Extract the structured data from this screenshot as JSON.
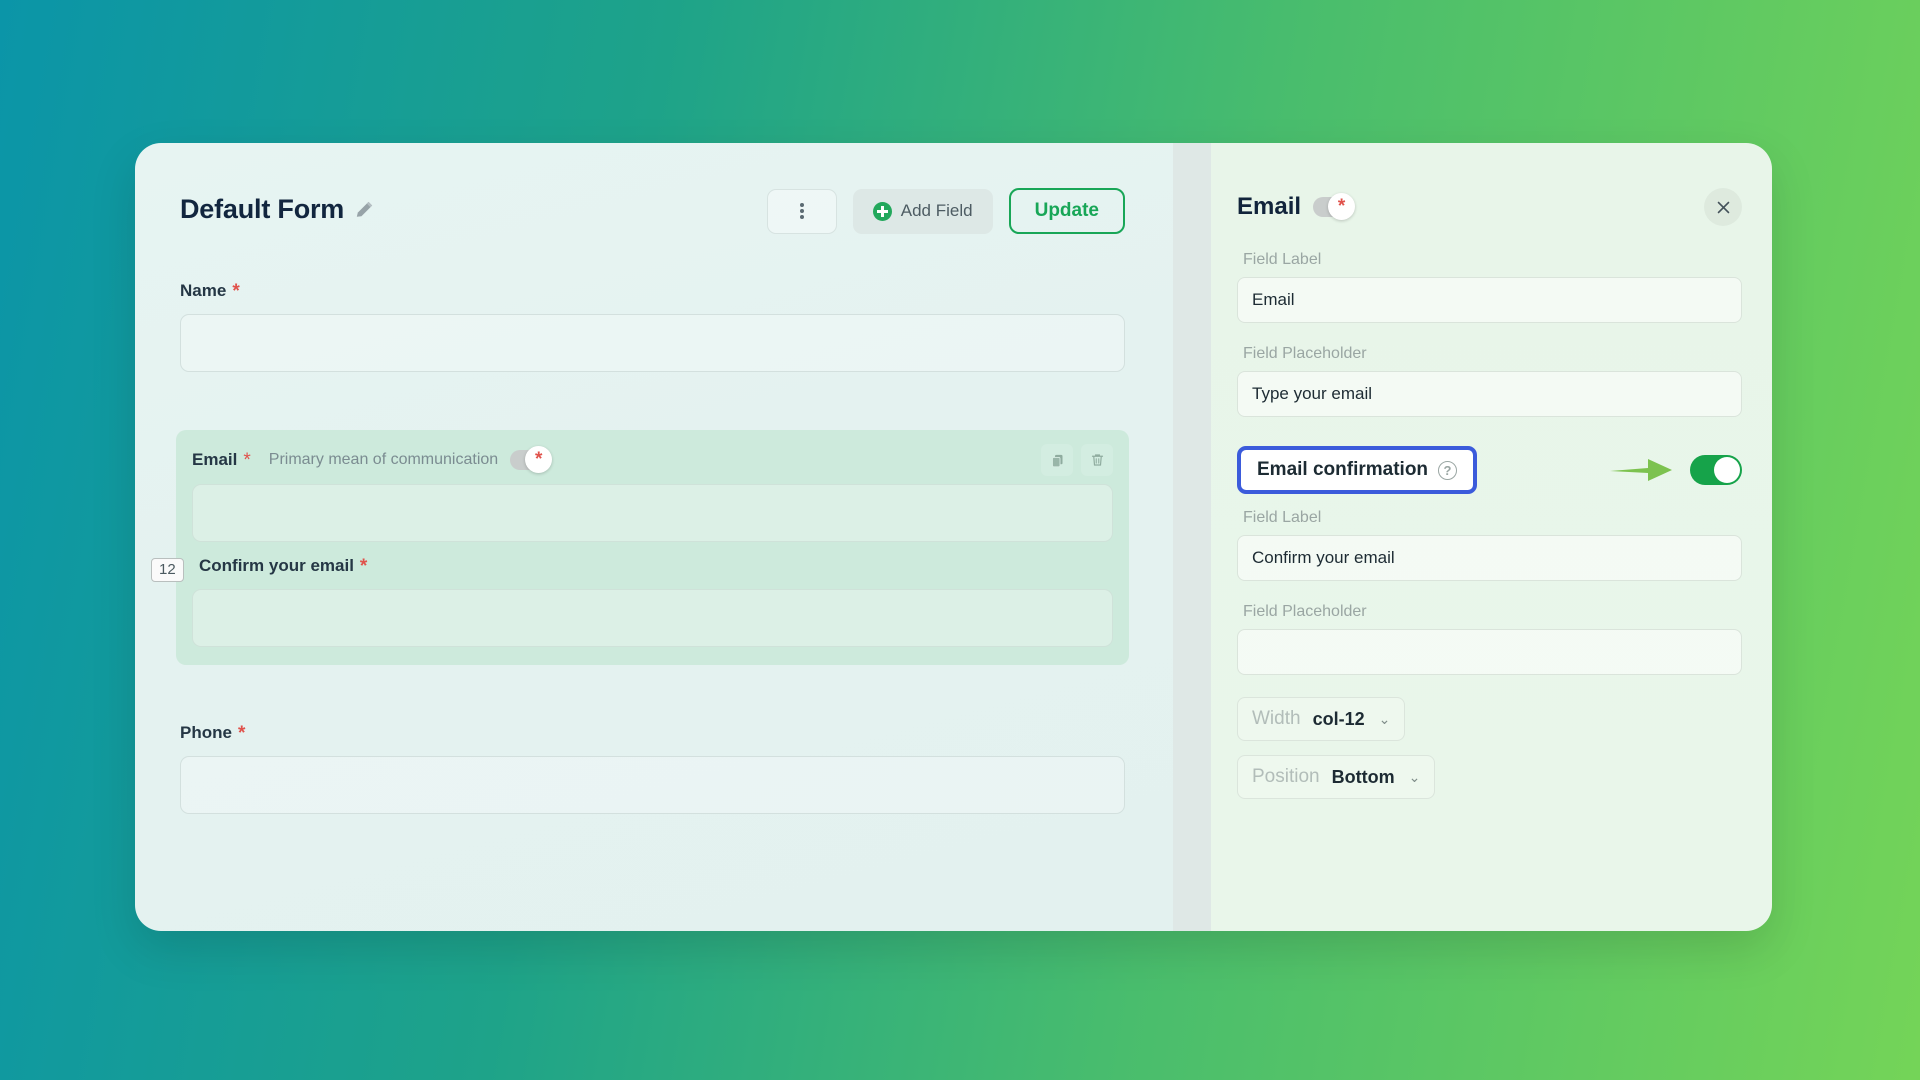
{
  "background": {
    "from": "#0b95a8",
    "to": "#74d458"
  },
  "builder": {
    "title": "Default Form",
    "edit_icon": "pencil-icon",
    "actions": {
      "kebab": "kebab-menu-icon",
      "add_field_label": "Add Field",
      "add_field_icon": "plus-circle-icon",
      "update_label": "Update"
    },
    "fields": [
      {
        "label": "Name",
        "required_marker": "*"
      },
      {
        "label": "Email",
        "required_marker": "*"
      },
      {
        "label": "Phone",
        "required_marker": "*"
      }
    ],
    "selected_group": {
      "title": "Email",
      "required_marker": "*",
      "subtitle": "Primary mean of communication",
      "toggle_state": "off",
      "toggle_glyph": "*",
      "copy_icon": "copy-icon",
      "delete_icon": "trash-icon",
      "column_badge": "12",
      "confirm_label": "Confirm your email",
      "confirm_required_marker": "*"
    }
  },
  "settings": {
    "title": "Email",
    "header_toggle_state": "off",
    "header_toggle_glyph": "*",
    "close_icon": "close-icon",
    "field_label_caption": "Field Label",
    "field_placeholder_caption": "Field Placeholder",
    "label_value": "Email",
    "placeholder_value": "Type your email",
    "confirmation": {
      "title": "Email confirmation",
      "help_icon": "question-mark-icon",
      "toggle_state": "on",
      "toggle_color": "#16a34a",
      "highlight_color": "#3b5bdb",
      "arrow_color": "#7cc24f",
      "field_label_caption": "Field Label",
      "label_value": "Confirm your email",
      "field_placeholder_caption": "Field Placeholder",
      "placeholder_value": ""
    },
    "width": {
      "key": "Width",
      "value": "col-12",
      "chevron": "chevron-down-icon"
    },
    "position": {
      "key": "Position",
      "value": "Bottom",
      "chevron": "chevron-down-icon"
    }
  }
}
